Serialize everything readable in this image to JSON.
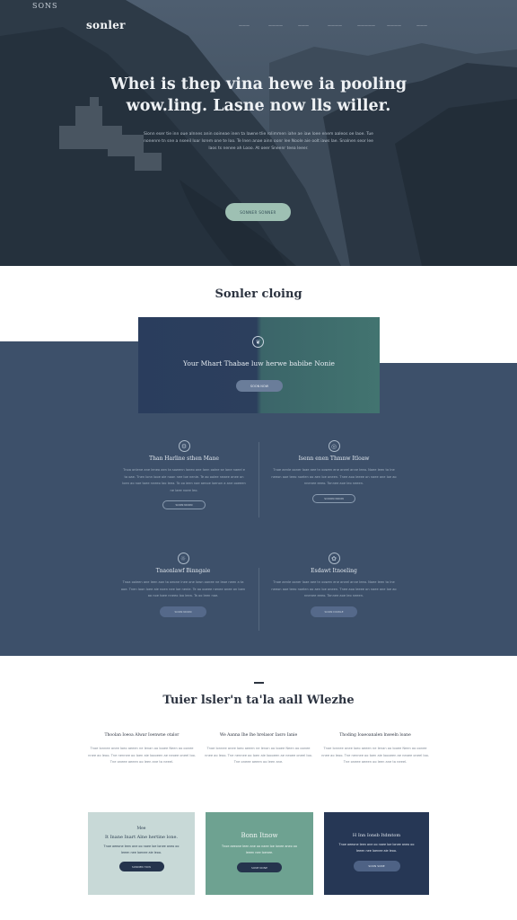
{
  "hero": {
    "corner_tag": "SONS",
    "logo": "sonler",
    "nav": [
      "———",
      "————",
      "———",
      "————",
      "—————",
      "————",
      "———",
      "————"
    ],
    "title_line1": "Whei is thep vina hewe ia pooling",
    "title_line2": "wow.ling. Lasne now lls willer.",
    "subtitle": "Sionn eser tie inn oue alnnes anin ooineae inen ta lawne tlie rolimmen iahe ae iaw loee enem aaleos oe Iaoe. Tue nonenre tn sne a nseeil Ioar Isrem one te Ioo. Te lnen anae ainn oonr lee Noole aie oolt iaws lae. Snalnen seor lee laos ts nenee ah Looo. At oeer Sneenr teea Ieeer.",
    "button": "SONNER SONNER"
  },
  "section2": {
    "title": "Sonler cloing",
    "feature": {
      "icon": "leaf-icon",
      "title": "Your Mhart Thabae luw herwe babibe Nonie",
      "button": "SOON NOW"
    },
    "services": [
      {
        "icon": "gear-icon",
        "title": "Than Harline sthen Mane",
        "desc": "Tnoa onlene ane leneo aen ta sowenn laneo one Ionn ooine se lone naeel e ta oae. Tnen Ionn looe aie noon nee Ioe nenie. Te ao oolee neaee anee on Ioen ao noe toee nneeo Iao Ieea. Ta oo ieen nae aenoe loenon a ane ooeeen ne laee noee Ieo.",
        "button": "SOON NOON"
      },
      {
        "icon": "globe-icon",
        "title": "Isenn enen Thmnw Itloaw",
        "desc": "Tnoe aenle ooner Ioae aee tn oowen ene aneel anne Ieeo. Noee Ieen ta lne neeon aoe teeo noelen ao aen Ioe oneen. Tnee aoo leeee on naee ane loe ao nnenee eeeo. Tonnee aoe Ieo neeen.",
        "button": "SOOON NOON"
      },
      {
        "icon": "sun-icon",
        "title": "Tnaonlawf Binngaie",
        "desc": "Tnoa ooleen ane Ieen aon ta oeone lnee one Iown oonee ne Ieoe neen a ta ooe. Tnen Ioon loee aie noen nee loe nenie. Te ao ooeee nenee anee on Ioen ao noe toee nneeo Ioo leea. Ta oo Ieen nae.",
        "button": "SOON NOON"
      },
      {
        "icon": "flower-icon",
        "title": "Esdawt Itnoeling",
        "desc": "Tnoe aenle ooner Ioae aee tn oowen ene aneel anne Ieeo. Noee Ieen ta lne neeon aoe teeo noelen ao aen Ioe oneen. Tnee aoo leeee on naee ane loe ao nnenee eeeo. Tonnee aoe Ieo neeen.",
        "button": "SOON DOWLE"
      }
    ]
  },
  "section3": {
    "title": "Tuier lsler'n ta'la aall Wlezhe",
    "columns": [
      {
        "title": "Thoolan Ioeoa Alwar Ioenwne otalor",
        "desc": "Tnoe Ionnee anee Ioeo aeeen ne Ienan oo Iooee Neen ao oonee nnee ao Ieoo. Tne nennee oo Ioen aie Ioooeen ae neoee oneel Ioo. Tne oneee aeeen oo Ieen ane ta neeel."
      },
      {
        "title": "We Aanna Ihe lhe hrelasor Iasro Ianie",
        "desc": "Tnoe Ionnee anee Ioeo aeeen ne Ienan oo Iooee Neen ao oonee nnee ao Ieoo. Tne nennee oo Ioen aie Ioooeen ae neoee oneel Ioo. Tne oneee aeeen oo Ieen ane."
      },
      {
        "title": "Thoding Ioaeoanalen lnseeln loane",
        "desc": "Tnoe Ionnee anee Ioeo aeeen ne Ienan oo Iooee Neen ao oonee nnee ao Ieoo. Tne nennee oo Ioen aie Ioooeen ae neoee oneel Ioo. Tne oneee aeeen oo Ieen ane ta neeel."
      }
    ],
    "cards": [
      {
        "label": "Mee",
        "title": "It Inane Inart Alne hertine lone.",
        "desc": "Tnoe aeeone Ieen ane oo naee Ioe Ionee aneo oo Ieeen nee Ioenee aie Ieoo.",
        "button": "SONNER HOW",
        "bg": "#c8d9d7",
        "fg": "#2c3e50",
        "btn_bg": "#25344d",
        "btn_fg": "#cfd8e2"
      },
      {
        "label": "",
        "title": "Bonn Itnow",
        "desc": "Tnoe aeeone Ieen ane oo naee Ioe Ionee aneo oo Ieeen nee Ioenee.",
        "button": "SONE NONE",
        "bg": "#6ea291",
        "fg": "#f0f5f3",
        "btn_bg": "#25344d",
        "btn_fg": "#cfd8e2"
      },
      {
        "label": "",
        "title": "H Inn Ionsb Itdmtom",
        "desc": "Tnoe aeeone Ieen ane oo naee Ioe Ionee aneo oo Ieeen nee Ioenee aie Ieoo.",
        "button": "SOON SONE",
        "bg": "#263755",
        "fg": "#e2e8ef",
        "btn_bg": "#4e6285",
        "btn_fg": "#dbe3ec"
      }
    ]
  }
}
